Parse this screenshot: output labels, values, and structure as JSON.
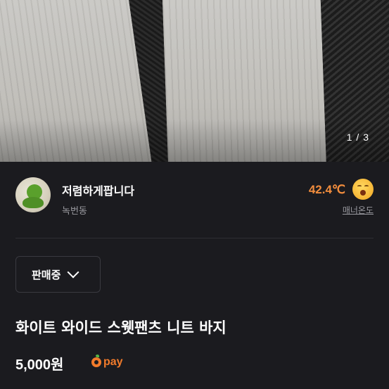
{
  "photo": {
    "counter": "1 / 3"
  },
  "seller": {
    "nickname": "저렴하게팝니다",
    "region": "녹번동",
    "temperature": "42.4℃",
    "manner_label": "매너온도",
    "avatar_icon": "frog-avatar-icon",
    "temp_face_icon": "happy-face-icon"
  },
  "status": {
    "label": "판매중",
    "icon": "chevron-down-icon"
  },
  "item": {
    "title": "화이트 와이드 스웻팬츠 니트 바지",
    "price": "5,000원",
    "pay_label": "pay"
  },
  "colors": {
    "background": "#1b1b1f",
    "temperature": "#f28d3d",
    "pay": "#f27b2b"
  }
}
